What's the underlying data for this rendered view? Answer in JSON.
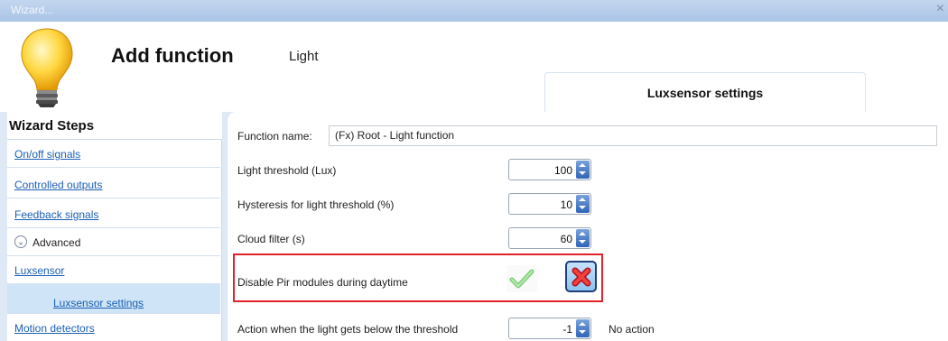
{
  "window": {
    "title": "Wizard...",
    "close": "×"
  },
  "header": {
    "heading": "Add function",
    "subheading": "Light",
    "tab": "Luxsensor settings"
  },
  "sidebar": {
    "title": "Wizard Steps",
    "items": [
      {
        "label": "On/off signals"
      },
      {
        "label": "Controlled outputs"
      },
      {
        "label": "Feedback signals"
      },
      {
        "label": "Advanced"
      },
      {
        "label": "Luxsensor"
      },
      {
        "label": "Luxsensor settings"
      },
      {
        "label": "Motion detectors"
      }
    ]
  },
  "form": {
    "function_name_label": "Function name:",
    "function_name_value": "(Fx) Root - Light function",
    "light_threshold_label": "Light threshold (Lux)",
    "light_threshold_value": "100",
    "hysteresis_label": "Hysteresis for light threshold (%)",
    "hysteresis_value": "10",
    "cloud_filter_label": "Cloud filter (s)",
    "cloud_filter_value": "60",
    "disable_pir_label": "Disable Pir modules during daytime",
    "action_below_label": "Action when the light gets below the threshold",
    "action_below_value": "-1",
    "action_below_text": "No action"
  },
  "colors": {
    "highlight_border": "#e2222a",
    "link": "#1a5fb4",
    "active_step": "#cfe4f6",
    "spin_button": "#2f64b7"
  },
  "icons": {
    "bulb": "lightbulb-icon",
    "yes": "check-icon",
    "no": "cross-icon",
    "advanced": "chevron-down-icon"
  }
}
